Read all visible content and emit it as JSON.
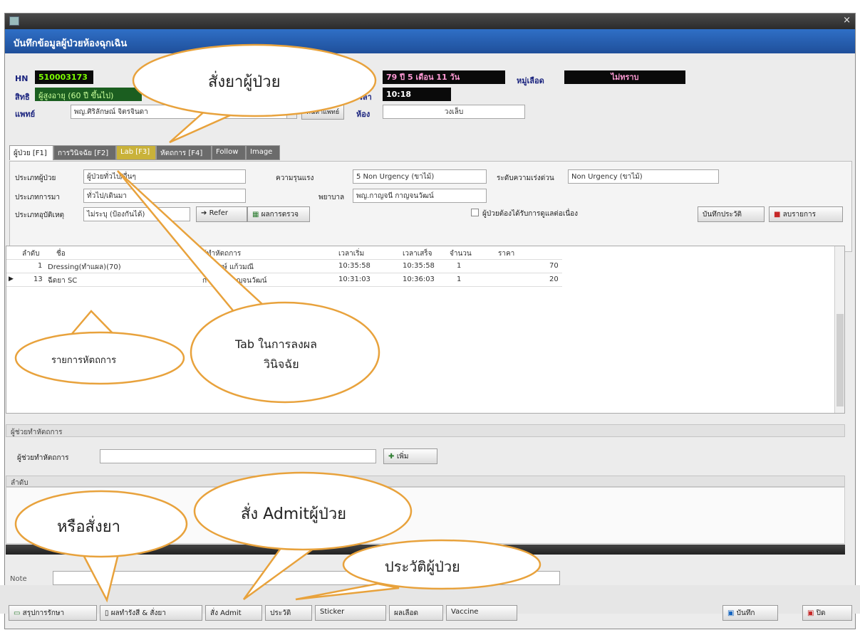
{
  "window": {
    "title": "",
    "close_glyph": "×"
  },
  "header": {
    "title": "บันทึกข้อมูลผู้ป่วยห้องฉุกเฉิน"
  },
  "patient": {
    "hn_label": "HN",
    "hn_value": "510003173",
    "age_value": "79 ปี 5 เดือน 11 วัน",
    "bloodgroup_label": "หมู่เลือด",
    "bloodgroup_value": "ไม่ทราบ",
    "right_label": "สิทธิ",
    "right_value": "ผู้สูงอายุ (60 ปี ขึ้นไป)",
    "time_label": "เวลา",
    "time_value": "10:18",
    "doctor_label": "แพทย์",
    "doctor_value": "พญ.ศิริลักษณ์ จิตรจินดา",
    "doctor_btn": "ค้นหาแพทย์",
    "room_label": "ห้อง",
    "room_value": "วงเล็บ"
  },
  "tabs": [
    {
      "label": "ผู้ป่วย [F1]"
    },
    {
      "label": "การวินิจฉัย [F2]"
    },
    {
      "label": "Lab [F3]"
    },
    {
      "label": "หัตถการ [F4]"
    },
    {
      "label": "Follow"
    },
    {
      "label": "Image"
    }
  ],
  "form": {
    "pt_type_label": "ประเภทผู้ป่วย",
    "pt_type_value": "ผู้ป่วยทั่วไป/อื่นๆ",
    "severity_label": "ความรุนแรง",
    "severity_value": "5 Non Urgency (ขาไม้)",
    "triage_label": "ระดับความเร่งด่วน",
    "triage_value": "Non Urgency (ขาไม้)",
    "arrival_label": "ประเภทการมา",
    "arrival_value": "ทั่วไป/เดินมา",
    "nurse_label": "พยาบาล",
    "nurse_value": "พญ.กาญจนี กาญจนวัฒน์",
    "accident_label": "ประเภทอุบัติเหตุ",
    "accident_value": "ไม่ระบุ (ป้องกันได้)",
    "refer_btn": "Refer",
    "vital_btn": "ผลการตรวจ",
    "check_label": "ผู้ป่วยต้องได้รับการดูแลต่อเนื่อง",
    "save_history_btn": "บันทึกประวัติ",
    "delete_btn": "ลบรายการ"
  },
  "grid": {
    "columns": [
      "ลำดับ",
      "ชื่อ",
      "ผู้ทำหัตถการ",
      "เวลาเริ่ม",
      "เวลาเสร็จ",
      "จำนวน",
      "ราคา"
    ],
    "rows": [
      {
        "no": "1",
        "name": "Dressing(ทำแผล)(70)",
        "by": "เชิดพงษ์ แก้วมณี",
        "start": "10:35:58",
        "end": "10:35:58",
        "qty": "1",
        "price": "70"
      },
      {
        "no": "13",
        "name": "ฉีดยา SC",
        "by": "กาญจนี กาญจนวัฒน์",
        "start": "10:31:03",
        "end": "10:36:03",
        "qty": "1",
        "price": "20"
      }
    ]
  },
  "assist": {
    "section_label": "ผู้ช่วยทำหัตถการ",
    "input_label": "ผู้ช่วยทำหัตถการ",
    "add_btn": "เพิ่ม",
    "subheader": "ลำดับ"
  },
  "note": {
    "label": "Note"
  },
  "bottom": {
    "buttons": [
      {
        "label": "สรุปการรักษา"
      },
      {
        "label": "ผลทำรังสี & สั่งยา"
      },
      {
        "label": "สั่ง Admit"
      },
      {
        "label": "ประวัติ"
      },
      {
        "label": "Sticker"
      },
      {
        "label": "ผลเลือด"
      },
      {
        "label": "Vaccine"
      }
    ],
    "save_btn": "บันทึก",
    "exit_btn": "ปิด"
  },
  "annotations": {
    "order_drug": "สั่งยาผู้ป่วย",
    "procedure_list": "รายการหัตถการ",
    "diag_tab_line1": "Tab ในการลงผล",
    "diag_tab_line2": "วินิจฉัย",
    "or_order": "หรือสั่งยา",
    "admit": "สั่ง Admitผู้ป่วย",
    "history": "ประวัติผู้ป่วย"
  },
  "colors": {
    "header_blue": "#2a62b5",
    "balloon_stroke": "#e8a23c",
    "value_green": "#7CFC00"
  }
}
